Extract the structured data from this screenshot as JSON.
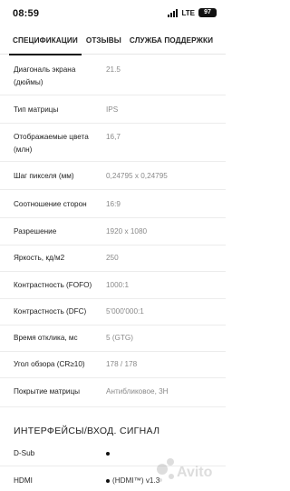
{
  "status_bar": {
    "time": "08:59",
    "network": "LTE",
    "battery": "97"
  },
  "tabs": [
    {
      "label": "СПЕЦИФИКАЦИИ",
      "active": true
    },
    {
      "label": "ОТЗЫВЫ",
      "active": false
    },
    {
      "label": "СЛУЖБА ПОДДЕРЖКИ",
      "active": false
    }
  ],
  "specs": [
    {
      "label": "Диагональ экрана (дюймы)",
      "value": "21.5"
    },
    {
      "label": "Тип матрицы",
      "value": "IPS"
    },
    {
      "label": "Отображаемые цвета (млн)",
      "value": "16,7"
    },
    {
      "label": "Шаг пикселя (мм)",
      "value": "0,24795 x 0,24795"
    },
    {
      "label": "Соотношение сторон",
      "value": "16:9"
    },
    {
      "label": "Разрешение",
      "value": "1920 x 1080"
    },
    {
      "label": "Яркость, кд/м2",
      "value": "250"
    },
    {
      "label": "Контрастность (FOFO)",
      "value": "1000:1"
    },
    {
      "label": "Контрастность (DFC)",
      "value": "5'000'000:1"
    },
    {
      "label": "Время отклика, мс",
      "value": "5 (GTG)"
    },
    {
      "label": "Угол обзора (CR≥10)",
      "value": "178 / 178"
    },
    {
      "label": "Покрытие матрицы",
      "value": "Антибликовое, 3H"
    }
  ],
  "interfaces": {
    "title": "ИНТЕРФЕЙСЫ/ВХОД. СИГНАЛ",
    "rows": [
      {
        "label": "D-Sub",
        "value": ""
      },
      {
        "label": "HDMI",
        "value": "(HDMI™) v1.3"
      }
    ]
  },
  "watermark": {
    "text": "Avito"
  }
}
